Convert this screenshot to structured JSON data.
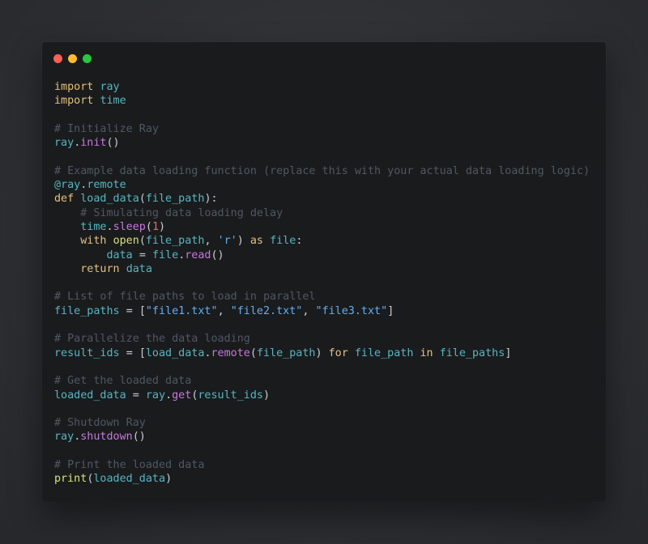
{
  "window": {
    "traffic_lights": [
      {
        "name": "close",
        "color": "#ff5f56"
      },
      {
        "name": "minimize",
        "color": "#ffbd2e"
      },
      {
        "name": "zoom",
        "color": "#27c93f"
      }
    ]
  },
  "code": {
    "language": "python",
    "lines": [
      [
        [
          "kw",
          "import"
        ],
        [
          "plain",
          " "
        ],
        [
          "id",
          "ray"
        ]
      ],
      [
        [
          "kw",
          "import"
        ],
        [
          "plain",
          " "
        ],
        [
          "id",
          "time"
        ]
      ],
      [],
      [
        [
          "cm",
          "# Initialize Ray"
        ]
      ],
      [
        [
          "id",
          "ray"
        ],
        [
          "punct",
          "."
        ],
        [
          "fn",
          "init"
        ],
        [
          "punct",
          "()"
        ]
      ],
      [],
      [
        [
          "cm",
          "# Example data loading function (replace this with your actual data loading logic)"
        ]
      ],
      [
        [
          "id",
          "@ray"
        ],
        [
          "punct",
          "."
        ],
        [
          "id",
          "remote"
        ]
      ],
      [
        [
          "kw",
          "def"
        ],
        [
          "plain",
          " "
        ],
        [
          "id",
          "load_data"
        ],
        [
          "punct",
          "("
        ],
        [
          "id",
          "file_path"
        ],
        [
          "punct",
          "):"
        ]
      ],
      [
        [
          "plain",
          "    "
        ],
        [
          "cm",
          "# Simulating data loading delay"
        ]
      ],
      [
        [
          "plain",
          "    "
        ],
        [
          "id",
          "time"
        ],
        [
          "punct",
          "."
        ],
        [
          "fn",
          "sleep"
        ],
        [
          "punct",
          "("
        ],
        [
          "num",
          "1"
        ],
        [
          "punct",
          ")"
        ]
      ],
      [
        [
          "plain",
          "    "
        ],
        [
          "kw",
          "with"
        ],
        [
          "plain",
          " "
        ],
        [
          "builtin",
          "open"
        ],
        [
          "punct",
          "("
        ],
        [
          "id",
          "file_path"
        ],
        [
          "punct",
          ", "
        ],
        [
          "str",
          "'r'"
        ],
        [
          "punct",
          ")"
        ],
        [
          "plain",
          " "
        ],
        [
          "kw",
          "as"
        ],
        [
          "plain",
          " "
        ],
        [
          "id",
          "file"
        ],
        [
          "punct",
          ":"
        ]
      ],
      [
        [
          "plain",
          "        "
        ],
        [
          "id",
          "data"
        ],
        [
          "plain",
          " "
        ],
        [
          "punct",
          "="
        ],
        [
          "plain",
          " "
        ],
        [
          "id",
          "file"
        ],
        [
          "punct",
          "."
        ],
        [
          "fn",
          "read"
        ],
        [
          "punct",
          "()"
        ]
      ],
      [
        [
          "plain",
          "    "
        ],
        [
          "kw",
          "return"
        ],
        [
          "plain",
          " "
        ],
        [
          "id",
          "data"
        ]
      ],
      [],
      [
        [
          "cm",
          "# List of file paths to load in parallel"
        ]
      ],
      [
        [
          "id",
          "file_paths"
        ],
        [
          "plain",
          " "
        ],
        [
          "punct",
          "="
        ],
        [
          "plain",
          " "
        ],
        [
          "punct",
          "["
        ],
        [
          "str",
          "\"file1.txt\""
        ],
        [
          "punct",
          ", "
        ],
        [
          "str",
          "\"file2.txt\""
        ],
        [
          "punct",
          ", "
        ],
        [
          "str",
          "\"file3.txt\""
        ],
        [
          "punct",
          "]"
        ]
      ],
      [],
      [
        [
          "cm",
          "# Parallelize the data loading"
        ]
      ],
      [
        [
          "id",
          "result_ids"
        ],
        [
          "plain",
          " "
        ],
        [
          "punct",
          "="
        ],
        [
          "plain",
          " "
        ],
        [
          "punct",
          "["
        ],
        [
          "id",
          "load_data"
        ],
        [
          "punct",
          "."
        ],
        [
          "fn",
          "remote"
        ],
        [
          "punct",
          "("
        ],
        [
          "id",
          "file_path"
        ],
        [
          "punct",
          ")"
        ],
        [
          "plain",
          " "
        ],
        [
          "kw",
          "for"
        ],
        [
          "plain",
          " "
        ],
        [
          "id",
          "file_path"
        ],
        [
          "plain",
          " "
        ],
        [
          "kw",
          "in"
        ],
        [
          "plain",
          " "
        ],
        [
          "id",
          "file_paths"
        ],
        [
          "punct",
          "]"
        ]
      ],
      [],
      [
        [
          "cm",
          "# Get the loaded data"
        ]
      ],
      [
        [
          "id",
          "loaded_data"
        ],
        [
          "plain",
          " "
        ],
        [
          "punct",
          "="
        ],
        [
          "plain",
          " "
        ],
        [
          "id",
          "ray"
        ],
        [
          "punct",
          "."
        ],
        [
          "fn",
          "get"
        ],
        [
          "punct",
          "("
        ],
        [
          "id",
          "result_ids"
        ],
        [
          "punct",
          ")"
        ]
      ],
      [],
      [
        [
          "cm",
          "# Shutdown Ray"
        ]
      ],
      [
        [
          "id",
          "ray"
        ],
        [
          "punct",
          "."
        ],
        [
          "fn",
          "shutdown"
        ],
        [
          "punct",
          "()"
        ]
      ],
      [],
      [
        [
          "cm",
          "# Print the loaded data"
        ]
      ],
      [
        [
          "builtin",
          "print"
        ],
        [
          "punct",
          "("
        ],
        [
          "id",
          "loaded_data"
        ],
        [
          "punct",
          ")"
        ]
      ]
    ]
  }
}
